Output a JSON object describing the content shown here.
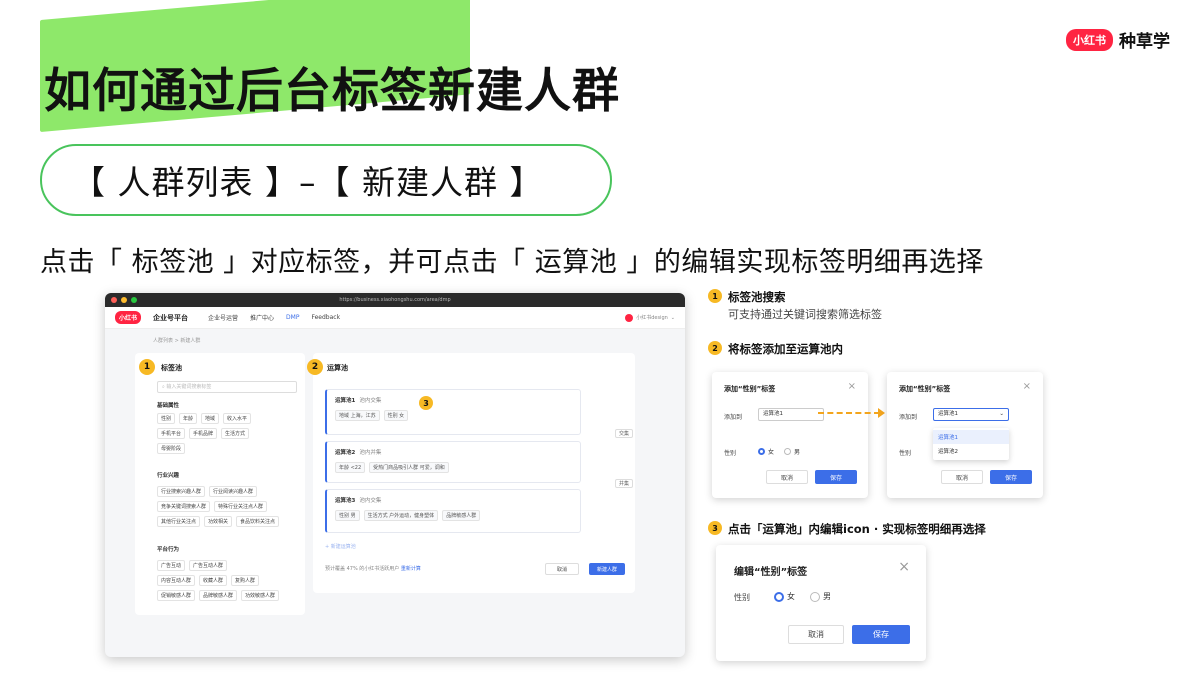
{
  "header": {
    "title": "如何通过后台标签新建人群",
    "breadcrumb_pill": "【 人群列表 】–【 新建人群 】",
    "instruction": "点击「 标签池 」对应标签，并可点击「 运算池 」的编辑实现标签明细再选择",
    "brand_logo": "小红书",
    "brand_name": "种草学"
  },
  "app": {
    "url": "https://business.xiaohongshu.com/area/dmp",
    "nav": {
      "logo": "小红书",
      "platform": "企业号平台",
      "items": [
        "企业号运营",
        "推广中心",
        "DMP",
        "Feedback"
      ],
      "active": "DMP",
      "user": "小红书design"
    },
    "breadcrumb": "人群列表 > 新建人群",
    "tag_pool": {
      "badge": "1",
      "title": "标签池",
      "search_placeholder": "输入关键词搜索标签",
      "sections": [
        {
          "title": "基础属性",
          "rows": [
            [
              "性别",
              "年龄",
              "地域",
              "收入水平"
            ],
            [
              "手机平台",
              "手机品牌",
              "生活方式"
            ],
            [
              "母婴阶段"
            ]
          ]
        },
        {
          "title": "行业兴趣",
          "rows": [
            [
              "行业搜索兴趣人群",
              "行业阅读兴趣人群"
            ],
            [
              "竞争关键词搜索人群",
              "特殊行业关注点人群"
            ],
            [
              "其他行业关注点",
              "功效相关",
              "食品饮料关注点"
            ]
          ]
        },
        {
          "title": "平台行为",
          "rows": [
            [
              "广告互动",
              "广告互动人群"
            ],
            [
              "内容互动人群",
              "收藏人群",
              "复购人群"
            ],
            [
              "促销敏感人群",
              "品牌敏感人群",
              "功效敏感人群"
            ]
          ]
        }
      ]
    },
    "calc_pool": {
      "badge": "2",
      "title": "运算池",
      "inner_badge": "3",
      "pools": [
        {
          "title": "运算池1",
          "sub": "池内交集",
          "tags": [
            "地域  上海，江苏",
            "性别  女"
          ]
        },
        {
          "title": "运算池2",
          "sub": "池内并集",
          "tags": [
            "年龄  <22",
            "受热门商品吸引人群  可爱，调和"
          ]
        },
        {
          "title": "运算池3",
          "sub": "池内交集",
          "tags": [
            "性别  男",
            "生活方式  户外运动，健身塑体",
            "品牌敏感人群"
          ]
        }
      ],
      "logic_1": "交集",
      "logic_2": "并集",
      "add_pool": "+ 新建运算池",
      "footer_prefix": "预计覆盖 47% 的小红书活跃用户",
      "footer_link": "重新计算",
      "cancel": "取消",
      "create": "新建人群"
    }
  },
  "steps": {
    "s1": {
      "num": "1",
      "title": "标签池搜索",
      "desc": "可支持通过关键词搜索筛选标签"
    },
    "s2": {
      "num": "2",
      "title": "将标签添加至运算池内"
    },
    "s3": {
      "num": "3",
      "title": "点击「运算池」内编辑icon · 实现标签明细再选择"
    }
  },
  "dialog_a": {
    "title": "添加“性别”标签",
    "add_to_label": "添加到",
    "add_to_value": "运算池1",
    "gender_label": "性别",
    "female": "女",
    "male": "男",
    "cancel": "取消",
    "save": "保存"
  },
  "dialog_b": {
    "title": "添加“性别”标签",
    "add_to_label": "添加到",
    "add_to_value": "运算池1",
    "options": [
      "运算池1",
      "运算池2"
    ],
    "gender_label": "性别",
    "cancel": "取消",
    "save": "保存"
  },
  "dialog_c": {
    "title": "编辑“性别”标签",
    "gender_label": "性别",
    "female": "女",
    "male": "男",
    "cancel": "取消",
    "save": "保存"
  },
  "colors": {
    "accent": "#3c6ee8",
    "highlight": "#8ee86a",
    "pill_border": "#49c45c",
    "badge": "#f7b924",
    "brand": "#ff2442"
  }
}
